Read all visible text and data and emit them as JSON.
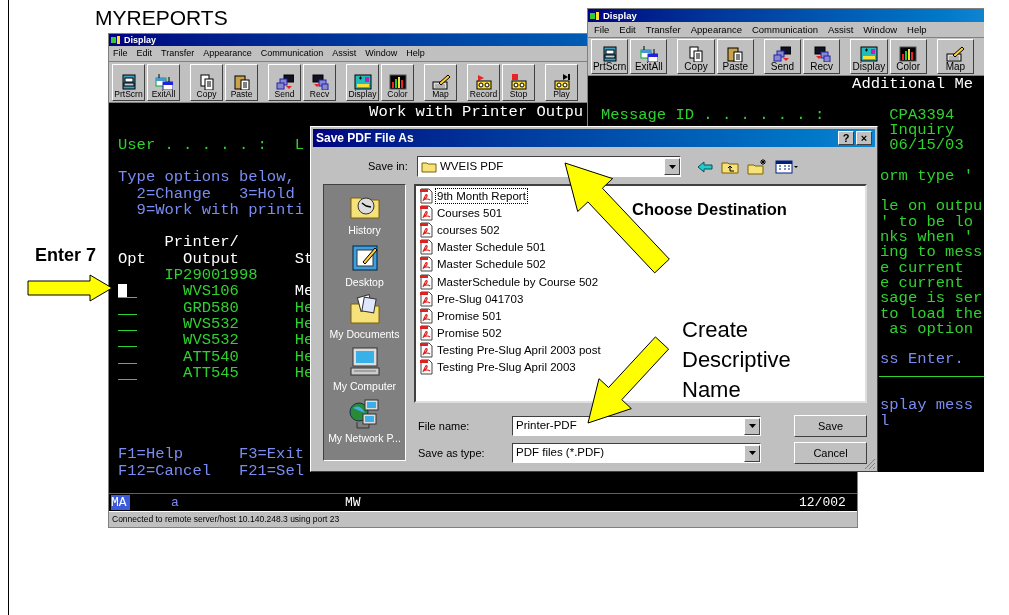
{
  "slide_title": "MYREPORTS",
  "windows": [
    {
      "title": "Display",
      "menu": [
        "File",
        "Edit",
        "Transfer",
        "Appearance",
        "Communication",
        "Assist",
        "Window",
        "Help"
      ],
      "toolbar": [
        "PrtScrn",
        "ExitAll",
        "Copy",
        "Paste",
        "Send",
        "Recv",
        "Display",
        "Color",
        "Map",
        "Record",
        "Stop",
        "Play"
      ],
      "terminal": [
        [
          {
            "kind": "text",
            "text": "Work with Printer Outpu",
            "color": "#ffffff"
          }
        ],
        [
          {
            "kind": "text",
            "text": "User . . . . . :",
            "color": "#2fd12f"
          },
          {
            "kind": "text",
            "text": "L",
            "color": "#2fd12f"
          }
        ],
        [
          {
            "kind": "text",
            "text": "Type options below,",
            "color": "#7a8cf2"
          }
        ],
        [
          {
            "kind": "text",
            "text": "2=Change",
            "color": "#7a8cf2"
          },
          {
            "kind": "text",
            "text": "3=Hold",
            "color": "#7a8cf2"
          }
        ],
        [
          {
            "kind": "text",
            "text": "9=Work with printi",
            "color": "#7a8cf2"
          }
        ],
        [
          {
            "kind": "text",
            "text": "Printer/",
            "color": "#ffffff"
          }
        ],
        [
          {
            "kind": "text",
            "text": "Opt",
            "color": "#ffffff"
          },
          {
            "kind": "text",
            "text": "Output",
            "color": "#ffffff"
          },
          {
            "kind": "text",
            "text": "St",
            "color": "#ffffff"
          }
        ],
        [
          {
            "kind": "text",
            "text": "IP29001998",
            "color": "#2fd12f"
          }
        ],
        [
          {
            "kind": "field",
            "cursor": true
          },
          {
            "kind": "text",
            "text": "WVS106",
            "color": "#2fd12f"
          },
          {
            "kind": "text",
            "text": "Me",
            "color": "#ffffff"
          }
        ],
        [
          {
            "kind": "field",
            "cursor": false
          },
          {
            "kind": "text",
            "text": "GRD580",
            "color": "#2fd12f"
          },
          {
            "kind": "text",
            "text": "He",
            "color": "#2fd12f"
          }
        ],
        [
          {
            "kind": "field",
            "cursor": false
          },
          {
            "kind": "text",
            "text": "WVS532",
            "color": "#2fd12f"
          },
          {
            "kind": "text",
            "text": "He",
            "color": "#2fd12f"
          }
        ],
        [
          {
            "kind": "field",
            "cursor": false
          },
          {
            "kind": "text",
            "text": "WVS532",
            "color": "#2fd12f"
          },
          {
            "kind": "text",
            "text": "He",
            "color": "#2fd12f"
          }
        ],
        [
          {
            "kind": "field",
            "cursor": false
          },
          {
            "kind": "text",
            "text": "ATT540",
            "color": "#2fd12f"
          },
          {
            "kind": "text",
            "text": "He",
            "color": "#2fd12f"
          }
        ],
        [
          {
            "kind": "field",
            "cursor": false
          },
          {
            "kind": "text",
            "text": "ATT545",
            "color": "#2fd12f"
          },
          {
            "kind": "text",
            "text": "He",
            "color": "#2fd12f"
          }
        ],
        [
          {
            "kind": "text",
            "text": "F1=Help",
            "color": "#7a8cf2"
          },
          {
            "kind": "text",
            "text": "F3=Exit",
            "color": "#7a8cf2"
          }
        ],
        [
          {
            "kind": "text",
            "text": "F12=Cancel",
            "color": "#7a8cf2"
          },
          {
            "kind": "text",
            "text": "F21=Sel",
            "color": "#7a8cf2"
          }
        ]
      ],
      "operator_line": [
        "MA",
        "a",
        "MW",
        "12/002"
      ],
      "status_bar": "Connected to remote server/host 10.140.248.3 using port 23"
    },
    {
      "title": "Display",
      "menu": [
        "File",
        "Edit",
        "Transfer",
        "Appearance",
        "Communication",
        "Assist",
        "Window",
        "Help"
      ],
      "toolbar": [
        "PrtScrn",
        "ExitAll",
        "Copy",
        "Paste",
        "Send",
        "Recv",
        "Display",
        "Color",
        "Map"
      ],
      "terminal": [
        [
          {
            "kind": "text",
            "text": "Additional Me",
            "color": "#ffffff"
          }
        ],
        [
          {
            "kind": "text",
            "text": "Message ID . . . . . . :",
            "color": "#2fd12f"
          },
          {
            "kind": "text",
            "text": "CPA3394",
            "color": "#2fd12f"
          }
        ],
        [
          {
            "kind": "text",
            "text": "Inquiry",
            "color": "#2fd12f"
          }
        ],
        [
          {
            "kind": "text",
            "text": "06/15/03",
            "color": "#2fd12f"
          }
        ],
        [
          {
            "kind": "text",
            "text": "orm type '",
            "color": "#2fd12f"
          }
        ],
        [
          {
            "kind": "text",
            "text": "le on outpu",
            "color": "#2fd12f"
          }
        ],
        [
          {
            "kind": "text",
            "text": "' to be lo",
            "color": "#2fd12f"
          }
        ],
        [
          {
            "kind": "text",
            "text": "nks when '",
            "color": "#2fd12f"
          }
        ],
        [
          {
            "kind": "text",
            "text": "ing to mess",
            "color": "#2fd12f"
          }
        ],
        [
          {
            "kind": "text",
            "text": "e current",
            "color": "#2fd12f"
          }
        ],
        [
          {
            "kind": "text",
            "text": "e current",
            "color": "#2fd12f"
          }
        ],
        [
          {
            "kind": "text",
            "text": "sage is ser",
            "color": "#2fd12f"
          }
        ],
        [
          {
            "kind": "text",
            "text": "to load the",
            "color": "#2fd12f"
          }
        ],
        [
          {
            "kind": "text",
            "text": "as option",
            "color": "#2fd12f"
          }
        ],
        [
          {
            "kind": "text",
            "text": "ss Enter.",
            "color": "#7a8cf2"
          }
        ],
        [
          {
            "kind": "text",
            "text": "splay mess",
            "color": "#7a8cf2"
          }
        ],
        [
          {
            "kind": "text",
            "text": "l",
            "color": "#7a8cf2"
          }
        ]
      ]
    }
  ],
  "dialog": {
    "title": "Save PDF File As",
    "title_buttons": [
      "?",
      "×"
    ],
    "save_in": {
      "label": "Save in:",
      "value": "WVEIS PDF"
    },
    "places": [
      "History",
      "Desktop",
      "My Documents",
      "My Computer",
      "My Network P..."
    ],
    "files": [
      {
        "name": "9th Month Report",
        "selected": true
      },
      {
        "name": "Courses 501",
        "selected": false
      },
      {
        "name": "courses 502",
        "selected": false
      },
      {
        "name": "Master Schedule 501",
        "selected": false
      },
      {
        "name": "Master Schedule 502",
        "selected": false
      },
      {
        "name": "MasterSchedule by Course 502",
        "selected": false
      },
      {
        "name": "Pre-Slug 041703",
        "selected": false
      },
      {
        "name": "Promise 501",
        "selected": false
      },
      {
        "name": "Promise 502",
        "selected": false
      },
      {
        "name": "Testing Pre-Slug April 2003 post",
        "selected": false
      },
      {
        "name": "Testing Pre-Slug April 2003",
        "selected": false
      }
    ],
    "file_name": {
      "label": "File name:",
      "value": "Printer-PDF"
    },
    "save_as_type": {
      "label": "Save as type:",
      "value": "PDF files (*.PDF)"
    },
    "buttons": [
      "Save",
      "Cancel"
    ]
  },
  "callouts": [
    "Enter 7",
    "Choose Destination",
    "Create Descriptive Name"
  ]
}
